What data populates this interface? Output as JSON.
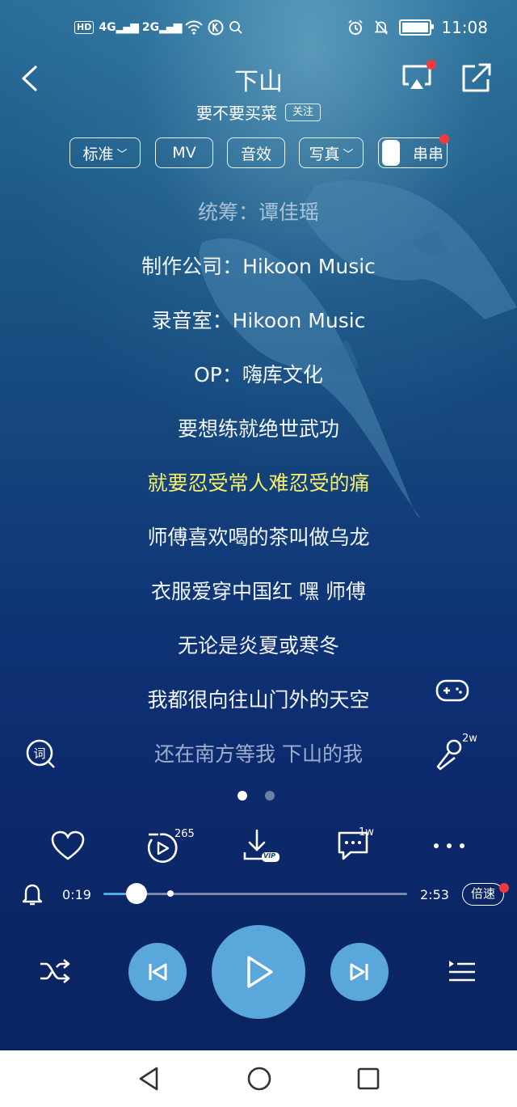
{
  "status_bar": {
    "hd_badge": "HD",
    "network_1": "4G",
    "network_2": "2G",
    "time": "11:08"
  },
  "header": {
    "title": "下山",
    "artist": "要不要买菜",
    "follow_label": "关注"
  },
  "tools": {
    "quality": "标准",
    "mv": "MV",
    "effects": "音效",
    "photo": "写真",
    "chuan": "串串"
  },
  "lyrics": [
    "统筹：谭佳瑶",
    "制作公司：Hikoon Music",
    "录音室：Hikoon Music",
    "OP：嗨库文化",
    "要想练就绝世武功",
    "就要忍受常人难忍受的痛",
    "师傅喜欢喝的茶叫做乌龙",
    "衣服爱穿中国红 嘿 师傅",
    "无论是炎夏或寒冬",
    "我都很向往山门外的天空",
    "还在南方等我 下山的我"
  ],
  "active_lyric_index": 5,
  "side": {
    "mic_count": "2w"
  },
  "actions": {
    "video_count": "265",
    "download_badge": "VIP",
    "comment_count": "1w"
  },
  "player": {
    "elapsed": "0:19",
    "total": "2:53",
    "progress": 0.11,
    "buffered": 0.22,
    "speed_label": "倍速"
  },
  "colors": {
    "accent": "#5aa7dc",
    "active_lyric": "#f6f06a",
    "badge_red": "#f23a3a"
  }
}
